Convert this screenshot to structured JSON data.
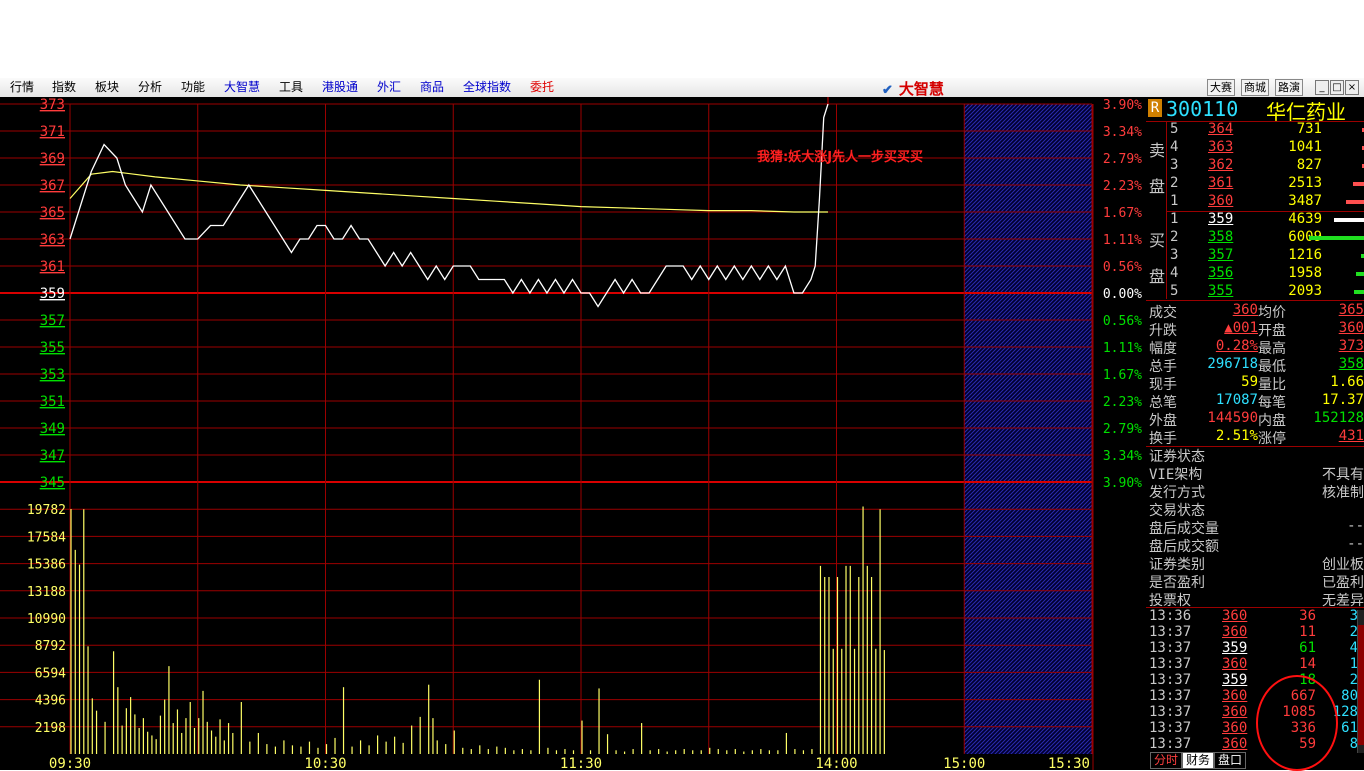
{
  "menu": [
    "行情",
    "指数",
    "板块",
    "分析",
    "功能",
    "大智慧",
    "工具",
    "港股通",
    "外汇",
    "商品",
    "全球指数",
    "委托"
  ],
  "brand": "大智慧",
  "right_buttons": [
    "大赛",
    "商城",
    "路演"
  ],
  "window_buttons": [
    "_",
    "□",
    "×"
  ],
  "colors": {
    "up": "#ff3c3c",
    "down": "#00e000",
    "grid": "#9b0000",
    "price_line": "#ffffff",
    "avg_line": "#ffff66",
    "volume": "#ffff66"
  },
  "annotation": "我猜:妖大涨J先人一步买买买",
  "stock": {
    "badge": "R",
    "code": "300110",
    "name": "华仁药业",
    "sell_label": [
      "卖",
      "盘"
    ],
    "buy_label": [
      "买",
      "盘"
    ],
    "asks": [
      {
        "level": "5",
        "price": "364",
        "volume": "731",
        "bar": 0.02
      },
      {
        "level": "4",
        "price": "363",
        "volume": "1041",
        "bar": 0.02
      },
      {
        "level": "3",
        "price": "362",
        "volume": "827",
        "bar": 0.02
      },
      {
        "level": "2",
        "price": "361",
        "volume": "2513",
        "bar": 0.11
      },
      {
        "level": "1",
        "price": "360",
        "volume": "3487",
        "bar": 0.18
      }
    ],
    "bids": [
      {
        "level": "1",
        "price": "359",
        "volume": "4639",
        "bar": 0.3
      },
      {
        "level": "2",
        "price": "358",
        "volume": "6009",
        "bar": 0.55
      },
      {
        "level": "3",
        "price": "357",
        "volume": "1216",
        "bar": 0.03
      },
      {
        "level": "4",
        "price": "356",
        "volume": "1958",
        "bar": 0.08
      },
      {
        "level": "5",
        "price": "355",
        "volume": "2093",
        "bar": 0.1
      }
    ],
    "stats": [
      {
        "l1": "成交",
        "v1": "360",
        "c1": "red",
        "l2": "均价",
        "v2": "365",
        "c2": "red"
      },
      {
        "l1": "升跌",
        "v1": "▲001",
        "c1": "red",
        "l2": "开盘",
        "v2": "360",
        "c2": "red"
      },
      {
        "l1": "幅度",
        "v1": "0.28%",
        "c1": "red",
        "l2": "最高",
        "v2": "373",
        "c2": "red"
      },
      {
        "l1": "总手",
        "v1": "296718",
        "c1": "cyan",
        "l2": "最低",
        "v2": "358",
        "c2": "green"
      },
      {
        "l1": "现手",
        "v1": "59",
        "c1": "yellow",
        "l2": "量比",
        "v2": "1.66",
        "c2": "yellow"
      },
      {
        "l1": "总笔",
        "v1": "17087",
        "c1": "cyan",
        "l2": "每笔",
        "v2": "17.37",
        "c2": "yellow"
      },
      {
        "l1": "外盘",
        "v1": "144590",
        "c1": "red",
        "l2": "内盘",
        "v2": "152128",
        "c2": "green"
      },
      {
        "l1": "换手",
        "v1": "2.51%",
        "c1": "yellow",
        "l2": "涨停",
        "v2": "431",
        "c2": "red"
      }
    ],
    "info": [
      {
        "label": "证券状态",
        "value": ""
      },
      {
        "label": "VIE架构",
        "value": "不具有"
      },
      {
        "label": "发行方式",
        "value": "核准制"
      },
      {
        "label": "交易状态",
        "value": ""
      },
      {
        "label": "盘后成交量",
        "value": "--"
      },
      {
        "label": "盘后成交额",
        "value": "--"
      },
      {
        "label": "证券类别",
        "value": "创业板"
      },
      {
        "label": "是否盈利",
        "value": "已盈利"
      },
      {
        "label": "投票权",
        "value": "无差异"
      }
    ],
    "ticks": [
      {
        "time": "13:36",
        "price": "360",
        "pc": "red",
        "vol": "36",
        "n": "3"
      },
      {
        "time": "13:37",
        "price": "360",
        "pc": "red",
        "vol": "11",
        "n": "2"
      },
      {
        "time": "13:37",
        "price": "359",
        "pc": "white",
        "vol": "61",
        "n": "4"
      },
      {
        "time": "13:37",
        "price": "360",
        "pc": "red",
        "vol": "14",
        "n": "1"
      },
      {
        "time": "13:37",
        "price": "359",
        "pc": "white",
        "vol": "18",
        "n": "2"
      },
      {
        "time": "13:37",
        "price": "360",
        "pc": "red",
        "vol": "667",
        "n": "80"
      },
      {
        "time": "13:37",
        "price": "360",
        "pc": "red",
        "vol": "1085",
        "n": "128"
      },
      {
        "time": "13:37",
        "price": "360",
        "pc": "red",
        "vol": "336",
        "n": "61"
      },
      {
        "time": "13:37",
        "price": "360",
        "pc": "red",
        "vol": "59",
        "n": "8"
      }
    ],
    "tabs": [
      "分时",
      "财务",
      "盘口"
    ]
  },
  "chart_data": {
    "type": "line",
    "prev_close": 359,
    "price_ticks": [
      "373",
      "371",
      "369",
      "367",
      "365",
      "363",
      "361",
      "359",
      "357",
      "355",
      "353",
      "351",
      "349",
      "347",
      "345"
    ],
    "pct_ticks": [
      "3.90%",
      "3.34%",
      "2.79%",
      "2.23%",
      "1.67%",
      "1.11%",
      "0.56%",
      "0.00%",
      "0.56%",
      "1.11%",
      "1.67%",
      "2.23%",
      "2.79%",
      "3.34%",
      "3.90%"
    ],
    "ylim": [
      345,
      373
    ],
    "volume_ticks": [
      "19782",
      "17584",
      "15386",
      "13188",
      "10990",
      "8792",
      "6594",
      "4396",
      "2198"
    ],
    "volume_max": 21980,
    "time_ticks": [
      "09:30",
      "10:30",
      "11:30",
      "14:00",
      "15:00",
      "15:30"
    ],
    "minutes_total": 240,
    "price_series": {
      "name": "price",
      "points": [
        [
          0,
          363
        ],
        [
          2,
          365
        ],
        [
          5,
          368
        ],
        [
          8,
          370
        ],
        [
          11,
          369
        ],
        [
          13,
          367
        ],
        [
          15,
          366
        ],
        [
          17,
          365
        ],
        [
          19,
          367
        ],
        [
          21,
          366
        ],
        [
          23,
          365
        ],
        [
          25,
          364
        ],
        [
          27,
          363
        ],
        [
          30,
          363
        ],
        [
          33,
          364
        ],
        [
          36,
          364
        ],
        [
          38,
          365
        ],
        [
          40,
          366
        ],
        [
          42,
          367
        ],
        [
          44,
          366
        ],
        [
          46,
          365
        ],
        [
          48,
          364
        ],
        [
          50,
          363
        ],
        [
          52,
          362
        ],
        [
          54,
          363
        ],
        [
          56,
          363
        ],
        [
          58,
          364
        ],
        [
          60,
          364
        ],
        [
          62,
          363
        ],
        [
          64,
          363
        ],
        [
          66,
          364
        ],
        [
          68,
          363
        ],
        [
          70,
          363
        ],
        [
          72,
          362
        ],
        [
          74,
          361
        ],
        [
          76,
          362
        ],
        [
          78,
          361
        ],
        [
          80,
          362
        ],
        [
          82,
          361
        ],
        [
          84,
          360
        ],
        [
          86,
          361
        ],
        [
          88,
          360
        ],
        [
          90,
          361
        ],
        [
          92,
          361
        ],
        [
          94,
          361
        ],
        [
          96,
          360
        ],
        [
          98,
          360
        ],
        [
          100,
          360
        ],
        [
          102,
          360
        ],
        [
          104,
          359
        ],
        [
          106,
          360
        ],
        [
          108,
          359
        ],
        [
          110,
          360
        ],
        [
          112,
          359
        ],
        [
          114,
          360
        ],
        [
          116,
          359
        ],
        [
          118,
          360
        ],
        [
          120,
          359
        ],
        [
          122,
          359
        ],
        [
          124,
          358
        ],
        [
          126,
          359
        ],
        [
          128,
          360
        ],
        [
          130,
          359
        ],
        [
          132,
          360
        ],
        [
          134,
          359
        ],
        [
          136,
          359
        ],
        [
          138,
          360
        ],
        [
          140,
          361
        ],
        [
          142,
          361
        ],
        [
          144,
          361
        ],
        [
          146,
          360
        ],
        [
          148,
          361
        ],
        [
          150,
          360
        ],
        [
          152,
          361
        ],
        [
          154,
          360
        ],
        [
          156,
          361
        ],
        [
          158,
          360
        ],
        [
          160,
          361
        ],
        [
          162,
          360
        ],
        [
          164,
          361
        ],
        [
          166,
          360
        ],
        [
          168,
          361
        ],
        [
          170,
          359
        ],
        [
          172,
          359
        ],
        [
          174,
          360
        ],
        [
          175,
          361
        ],
        [
          176,
          366
        ],
        [
          177,
          372
        ],
        [
          178,
          373
        ]
      ]
    },
    "avg_series": {
      "name": "average",
      "points": [
        [
          0,
          366
        ],
        [
          5,
          367.8
        ],
        [
          10,
          368
        ],
        [
          20,
          367.6
        ],
        [
          30,
          367.3
        ],
        [
          40,
          367
        ],
        [
          50,
          366.8
        ],
        [
          60,
          366.6
        ],
        [
          70,
          366.4
        ],
        [
          80,
          366.2
        ],
        [
          90,
          366
        ],
        [
          100,
          365.8
        ],
        [
          110,
          365.6
        ],
        [
          120,
          365.4
        ],
        [
          130,
          365.3
        ],
        [
          140,
          365.2
        ],
        [
          150,
          365.1
        ],
        [
          160,
          365.1
        ],
        [
          170,
          365
        ],
        [
          175,
          365
        ],
        [
          178,
          365
        ]
      ]
    },
    "volumes": [
      [
        0,
        19800
      ],
      [
        1,
        16500
      ],
      [
        2,
        15300
      ],
      [
        3,
        19782
      ],
      [
        4,
        8700
      ],
      [
        5,
        4500
      ],
      [
        6,
        3500
      ],
      [
        8,
        2600
      ],
      [
        10,
        8300
      ],
      [
        11,
        5400
      ],
      [
        12,
        2300
      ],
      [
        13,
        3700
      ],
      [
        14,
        4600
      ],
      [
        15,
        3200
      ],
      [
        16,
        2100
      ],
      [
        17,
        2900
      ],
      [
        18,
        1800
      ],
      [
        19,
        1500
      ],
      [
        20,
        1200
      ],
      [
        21,
        3100
      ],
      [
        22,
        4400
      ],
      [
        23,
        7100
      ],
      [
        24,
        2500
      ],
      [
        25,
        3600
      ],
      [
        26,
        1700
      ],
      [
        27,
        2900
      ],
      [
        28,
        4200
      ],
      [
        29,
        2100
      ],
      [
        30,
        2900
      ],
      [
        31,
        5100
      ],
      [
        32,
        2600
      ],
      [
        33,
        1900
      ],
      [
        34,
        1400
      ],
      [
        35,
        2800
      ],
      [
        36,
        1100
      ],
      [
        37,
        2500
      ],
      [
        38,
        1700
      ],
      [
        40,
        4200
      ],
      [
        42,
        1000
      ],
      [
        44,
        1700
      ],
      [
        46,
        800
      ],
      [
        48,
        600
      ],
      [
        50,
        1100
      ],
      [
        52,
        700
      ],
      [
        54,
        600
      ],
      [
        56,
        1000
      ],
      [
        58,
        500
      ],
      [
        60,
        800
      ],
      [
        62,
        1300
      ],
      [
        64,
        5400
      ],
      [
        66,
        600
      ],
      [
        68,
        1100
      ],
      [
        70,
        700
      ],
      [
        72,
        1500
      ],
      [
        74,
        1000
      ],
      [
        76,
        1400
      ],
      [
        78,
        900
      ],
      [
        80,
        2300
      ],
      [
        82,
        3000
      ],
      [
        84,
        5600
      ],
      [
        85,
        2900
      ],
      [
        86,
        1100
      ],
      [
        88,
        800
      ],
      [
        90,
        1900
      ],
      [
        92,
        500
      ],
      [
        94,
        400
      ],
      [
        96,
        700
      ],
      [
        98,
        400
      ],
      [
        100,
        600
      ],
      [
        102,
        500
      ],
      [
        104,
        300
      ],
      [
        106,
        400
      ],
      [
        108,
        300
      ],
      [
        110,
        6000
      ],
      [
        112,
        500
      ],
      [
        114,
        300
      ],
      [
        116,
        400
      ],
      [
        118,
        300
      ],
      [
        120,
        2700
      ],
      [
        122,
        300
      ],
      [
        124,
        5300
      ],
      [
        126,
        1600
      ],
      [
        128,
        300
      ],
      [
        130,
        200
      ],
      [
        132,
        400
      ],
      [
        134,
        2500
      ],
      [
        136,
        300
      ],
      [
        138,
        400
      ],
      [
        140,
        200
      ],
      [
        142,
        300
      ],
      [
        144,
        400
      ],
      [
        146,
        300
      ],
      [
        148,
        300
      ],
      [
        150,
        500
      ],
      [
        152,
        400
      ],
      [
        154,
        300
      ],
      [
        156,
        400
      ],
      [
        158,
        200
      ],
      [
        160,
        300
      ],
      [
        162,
        400
      ],
      [
        164,
        300
      ],
      [
        166,
        300
      ],
      [
        168,
        1700
      ],
      [
        170,
        400
      ],
      [
        172,
        300
      ],
      [
        174,
        400
      ],
      [
        176,
        15200
      ],
      [
        177,
        14300
      ],
      [
        178,
        14300
      ],
      [
        179,
        8500
      ],
      [
        180,
        14300
      ],
      [
        181,
        8500
      ],
      [
        182,
        15200
      ],
      [
        183,
        15200
      ],
      [
        184,
        8500
      ],
      [
        185,
        14300
      ],
      [
        186,
        20000
      ],
      [
        187,
        15200
      ],
      [
        188,
        14300
      ],
      [
        189,
        8500
      ],
      [
        190,
        19782
      ],
      [
        191,
        8400
      ]
    ]
  }
}
